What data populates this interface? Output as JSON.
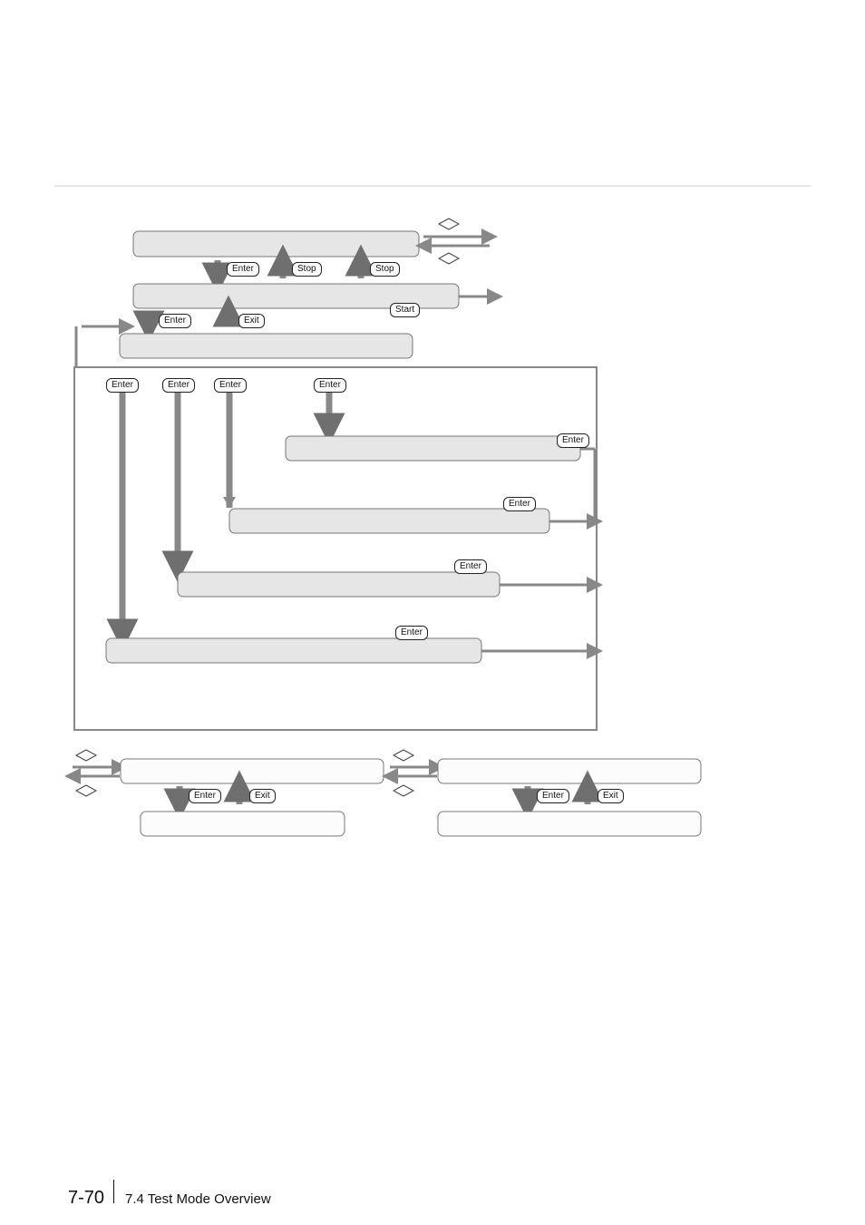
{
  "buttons": {
    "enter": "Enter",
    "stop": "Stop",
    "start": "Start",
    "exit": "Exit"
  },
  "footer": {
    "page": "7-70",
    "section": "7.4 Test Mode Overview"
  }
}
